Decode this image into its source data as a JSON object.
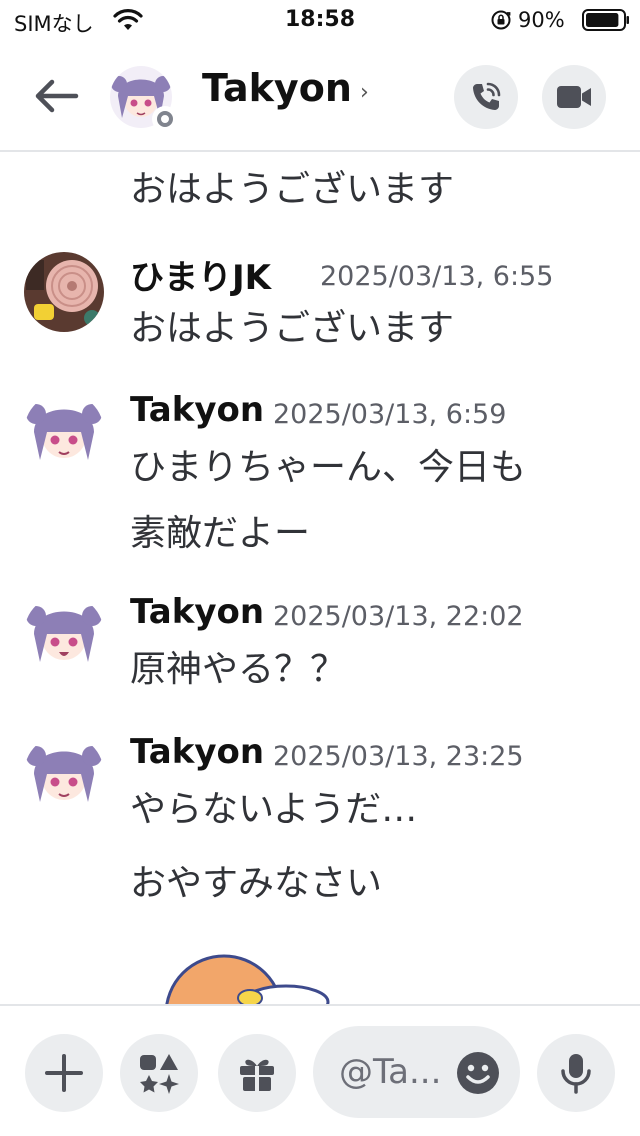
{
  "status_bar": {
    "carrier": "SIMなし",
    "time": "18:58",
    "battery_percent": "90%",
    "battery_level": 0.9
  },
  "header": {
    "title": "Takyon",
    "chevron": "›",
    "status": "offline"
  },
  "messages": [
    {
      "continuation": true,
      "lines": [
        "おはようございます"
      ]
    },
    {
      "author": "ひまりJK",
      "timestamp": "2025/03/13, 6:55",
      "lines": [
        "おはようございます"
      ]
    },
    {
      "author": "Takyon",
      "timestamp": "2025/03/13, 6:59",
      "lines": [
        "ひまりちゃーん、今日も",
        "素敵だよー"
      ]
    },
    {
      "author": "Takyon",
      "timestamp": "2025/03/13, 22:02",
      "lines": [
        "原神やる？？"
      ]
    },
    {
      "author": "Takyon",
      "timestamp": "2025/03/13, 23:25",
      "lines": [
        "やらないようだ…",
        "おやすみなさい"
      ]
    }
  ],
  "composer": {
    "placeholder": "@Ta..."
  },
  "icons": {
    "back": "arrow-left-icon",
    "call": "phone-call-icon",
    "video": "video-camera-icon",
    "plus": "plus-icon",
    "apps": "apps-icon",
    "gift": "gift-icon",
    "emoji": "emoji-icon",
    "mic": "microphone-icon"
  },
  "colors": {
    "button_bg": "#ebedef",
    "status_offline": "#80848e",
    "text": "#313338"
  }
}
